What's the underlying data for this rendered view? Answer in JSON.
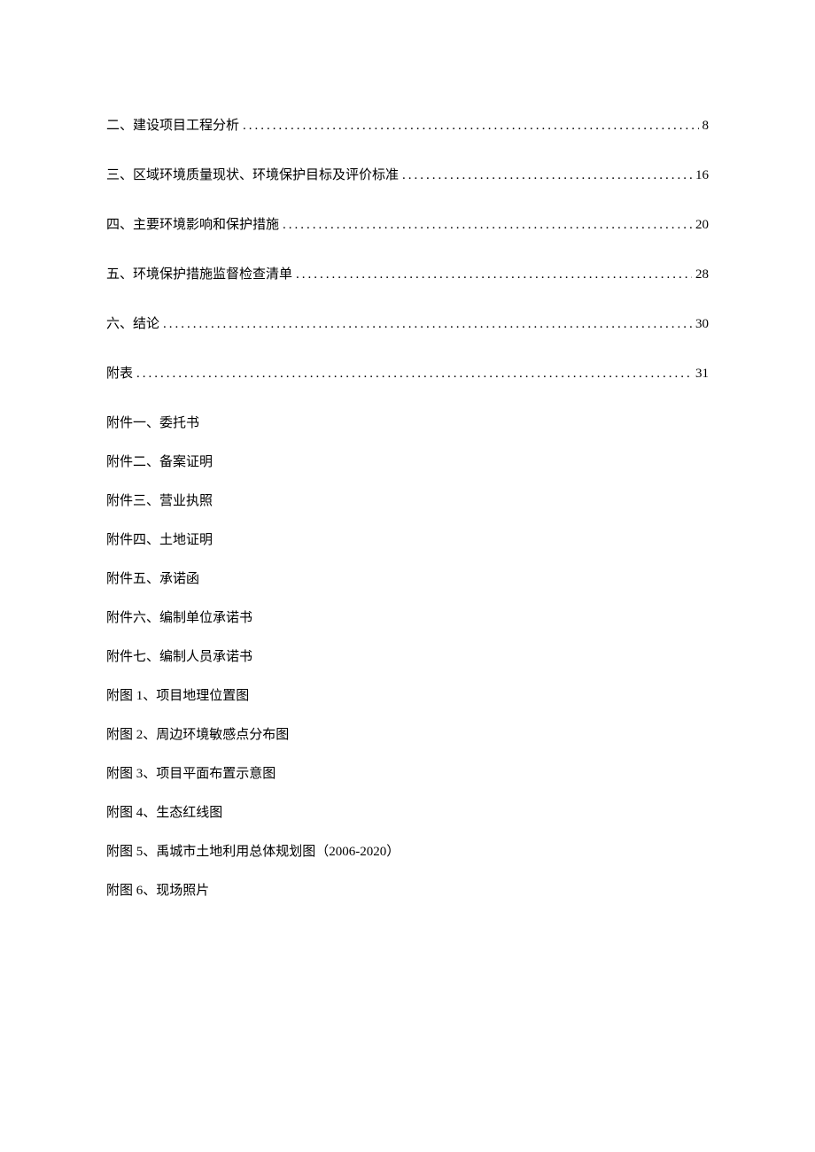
{
  "toc": [
    {
      "title": "二、建设项目工程分析",
      "page": "8"
    },
    {
      "title": "三、区域环境质量现状、环境保护目标及评价标准",
      "page": "16"
    },
    {
      "title": "四、主要环境影响和保护措施",
      "page": "20"
    },
    {
      "title": "五、环境保护措施监督检查清单",
      "page": "28"
    },
    {
      "title": "六、结论",
      "page": "30"
    },
    {
      "title": "附表",
      "page": "31"
    }
  ],
  "attachments": [
    "附件一、委托书",
    "附件二、备案证明",
    "附件三、营业执照",
    "附件四、土地证明",
    "附件五、承诺函",
    "附件六、编制单位承诺书",
    "附件七、编制人员承诺书",
    "附图 1、项目地理位置图",
    "附图 2、周边环境敏感点分布图",
    "附图 3、项目平面布置示意图",
    "附图 4、生态红线图",
    "附图 5、禹城市土地利用总体规划图（2006-2020）",
    "附图 6、现场照片"
  ],
  "dots": "...................................................................................................."
}
